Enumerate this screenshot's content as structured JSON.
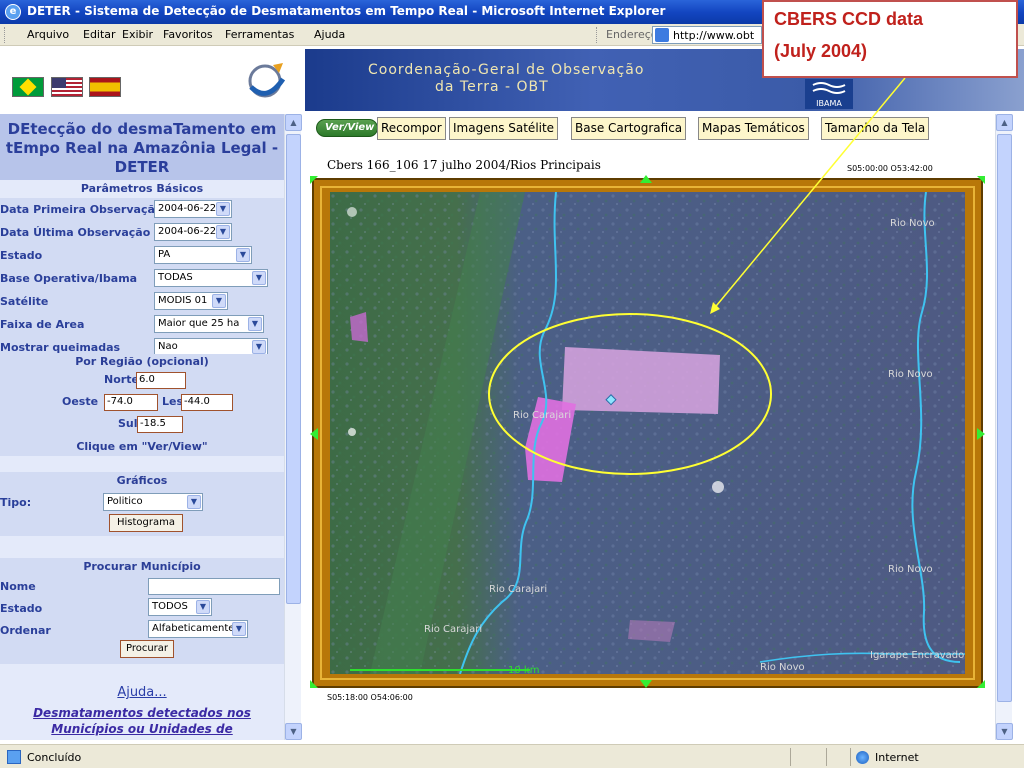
{
  "window": {
    "title": "DETER - Sistema de Detecção de Desmatamentos em Tempo Real - Microsoft Internet Explorer"
  },
  "menubar": {
    "items": [
      "Arquivo",
      "Editar",
      "Exibir",
      "Favoritos",
      "Ferramentas",
      "Ajuda"
    ],
    "address_label": "Endereço",
    "address_value": "http://www.obt"
  },
  "callout": {
    "line1": "CBERS CCD data",
    "line2": "(July 2004)",
    "color": "#c0211c"
  },
  "banner": {
    "line1": "Coordenação-Geral de Observação",
    "line2": "da Terra - OBT",
    "obt_logo": "OBT",
    "ibama": "IBAMA",
    "inpe": "INPE"
  },
  "left": {
    "title": "DEtecção do desmaTamento em tEmpo Real na Amazônia Legal - DETER",
    "basic_params_header": "Parâmetros Básicos",
    "fields": [
      {
        "label": "Data Primeira Observação",
        "value": "2004-06-22"
      },
      {
        "label": "Data Última Observação",
        "value": "2004-06-22"
      },
      {
        "label": "Estado",
        "value": "PA"
      },
      {
        "label": "Base Operativa/Ibama",
        "value": "TODAS"
      },
      {
        "label": "Satélite",
        "value": "MODIS 01"
      },
      {
        "label": "Faixa de Area",
        "value": "Maior que 25 ha"
      },
      {
        "label": "Mostrar queimadas",
        "value": "Nao"
      }
    ],
    "region_header": "Por Região (opcional)",
    "north_label": "Norte",
    "north_value": "6.0",
    "west_label": "Oeste",
    "west_value": "-74.0",
    "east_label": "Leste",
    "east_value": "-44.0",
    "south_label": "Sul",
    "south_value": "-18.5",
    "click_hint": "Clique em \"Ver/View\"",
    "graphs_header": "Gráficos",
    "type_label": "Tipo:",
    "type_value": "Politico",
    "histogram_button": "Histograma",
    "search_header": "Procurar Município",
    "name_label": "Nome",
    "name_value": "",
    "state_label": "Estado",
    "state_value": "TODOS",
    "order_label": "Ordenar",
    "order_value": "Alfabeticamente",
    "search_button": "Procurar",
    "help_link": "Ajuda...",
    "detected_link_1": "Desmatamentos detectados nos",
    "detected_link_2": "Municípios ou Unidades de"
  },
  "right": {
    "tabs": [
      "Ver/View",
      "Recompor",
      "Imagens Satélite",
      "Base Cartografica",
      "Mapas Temáticos",
      "Tamanho da Tela"
    ],
    "caption": "Cbers 166_106 17 julho 2004/Rios Principais",
    "coord_ne": "S05:00:00 O53:42:00",
    "coord_sw": "S05:18:00 O54:06:00",
    "scale": "10 km",
    "places": [
      "Rio Novo",
      "Rio Novo",
      "Rio Carajari",
      "Rio Novo",
      "Rio Carajari",
      "Rio Carajari",
      "Rio Novo",
      "Igarape Encravado"
    ],
    "colors": {
      "frame": "#b87709",
      "river": "#3fc3f0",
      "highlight": "#ffff33",
      "clearing": "#e47ce0"
    }
  },
  "status": {
    "text": "Concluído",
    "zone": "Internet"
  }
}
